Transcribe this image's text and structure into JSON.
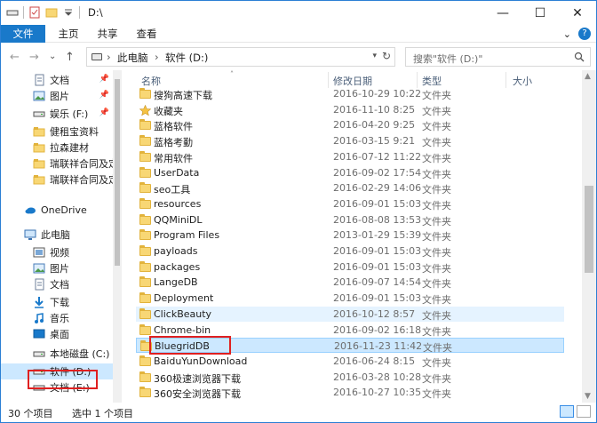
{
  "window": {
    "title": "D:\\",
    "controls": {
      "minimize": "—",
      "maximize": "☐",
      "close": "✕"
    }
  },
  "ribbon": {
    "tabs": [
      "文件",
      "主页",
      "共享",
      "查看"
    ],
    "collapse": "⌄",
    "help": "?"
  },
  "address": {
    "crumbs": [
      "此电脑",
      "软件 (D:)"
    ],
    "separator": "›",
    "search_placeholder": "搜索\"软件 (D:)\""
  },
  "nav": {
    "back": "←",
    "forward": "→",
    "recent": "⌄",
    "up": "↑"
  },
  "sidebar": {
    "items": [
      {
        "label": "文档",
        "icon": "document-icon",
        "pinned": true
      },
      {
        "label": "图片",
        "icon": "picture-icon",
        "pinned": true
      },
      {
        "label": "娱乐 (F:)",
        "icon": "drive-icon",
        "pinned": true
      },
      {
        "label": "健租宝资料",
        "icon": "folder-icon",
        "pinned": false
      },
      {
        "label": "拉森建材",
        "icon": "folder-icon",
        "pinned": false
      },
      {
        "label": "瑞联祥合同及定",
        "icon": "folder-icon",
        "pinned": false
      },
      {
        "label": "瑞联祥合同及定",
        "icon": "folder-icon",
        "pinned": false
      },
      {
        "label": "OneDrive",
        "icon": "cloud-icon",
        "pinned": false
      },
      {
        "label": "此电脑",
        "icon": "computer-icon",
        "pinned": false
      },
      {
        "label": "视频",
        "icon": "video-icon",
        "pinned": false
      },
      {
        "label": "图片",
        "icon": "picture-icon",
        "pinned": false
      },
      {
        "label": "文档",
        "icon": "document-icon",
        "pinned": false
      },
      {
        "label": "下载",
        "icon": "download-icon",
        "pinned": false
      },
      {
        "label": "音乐",
        "icon": "music-icon",
        "pinned": false
      },
      {
        "label": "桌面",
        "icon": "desktop-icon",
        "pinned": false
      },
      {
        "label": "本地磁盘 (C:)",
        "icon": "drive-icon",
        "pinned": false
      },
      {
        "label": "软件 (D:)",
        "icon": "drive-icon",
        "pinned": false,
        "selected": true
      },
      {
        "label": "文档 (E:)",
        "icon": "drive-icon",
        "pinned": false
      }
    ]
  },
  "columns": {
    "name": "名称",
    "modified": "修改日期",
    "type": "类型",
    "size": "大小"
  },
  "files": [
    {
      "name": "搜狗高速下载",
      "modified": "2016-10-29 10:22",
      "type": "文件夹"
    },
    {
      "name": "收藏夹",
      "modified": "2016-11-10 8:25",
      "type": "文件夹",
      "icon": "star"
    },
    {
      "name": "蓝格软件",
      "modified": "2016-04-20 9:25",
      "type": "文件夹"
    },
    {
      "name": "蓝格考勤",
      "modified": "2016-03-15 9:21",
      "type": "文件夹"
    },
    {
      "name": "常用软件",
      "modified": "2016-07-12 11:22",
      "type": "文件夹"
    },
    {
      "name": "UserData",
      "modified": "2016-09-02 17:54",
      "type": "文件夹"
    },
    {
      "name": "seo工具",
      "modified": "2016-02-29 14:06",
      "type": "文件夹"
    },
    {
      "name": "resources",
      "modified": "2016-09-01 15:03",
      "type": "文件夹"
    },
    {
      "name": "QQMiniDL",
      "modified": "2016-08-08 13:53",
      "type": "文件夹"
    },
    {
      "name": "Program Files",
      "modified": "2013-01-29 15:39",
      "type": "文件夹"
    },
    {
      "name": "payloads",
      "modified": "2016-09-01 15:03",
      "type": "文件夹"
    },
    {
      "name": "packages",
      "modified": "2016-09-01 15:03",
      "type": "文件夹"
    },
    {
      "name": "LangeDB",
      "modified": "2016-09-07 14:54",
      "type": "文件夹"
    },
    {
      "name": "Deployment",
      "modified": "2016-09-01 15:03",
      "type": "文件夹"
    },
    {
      "name": "ClickBeauty",
      "modified": "2016-10-12 8:57",
      "type": "文件夹",
      "state": "hover"
    },
    {
      "name": "Chrome-bin",
      "modified": "2016-09-02 16:18",
      "type": "文件夹"
    },
    {
      "name": "BluegridDB",
      "modified": "2016-11-23 11:42",
      "type": "文件夹",
      "state": "selected"
    },
    {
      "name": "BaiduYunDownload",
      "modified": "2016-06-24 8:15",
      "type": "文件夹"
    },
    {
      "name": "360极速浏览器下载",
      "modified": "2016-03-28 10:28",
      "type": "文件夹"
    },
    {
      "name": "360安全浏览器下载",
      "modified": "2016-10-27 10:35",
      "type": "文件夹"
    }
  ],
  "status": {
    "count": "30 个项目",
    "selection": "选中 1 个项目"
  },
  "colors": {
    "accent": "#1979ca",
    "selection": "#cce8ff",
    "hover": "#e5f3ff",
    "highlight_box": "#e02020",
    "folder": "#f8d775"
  }
}
